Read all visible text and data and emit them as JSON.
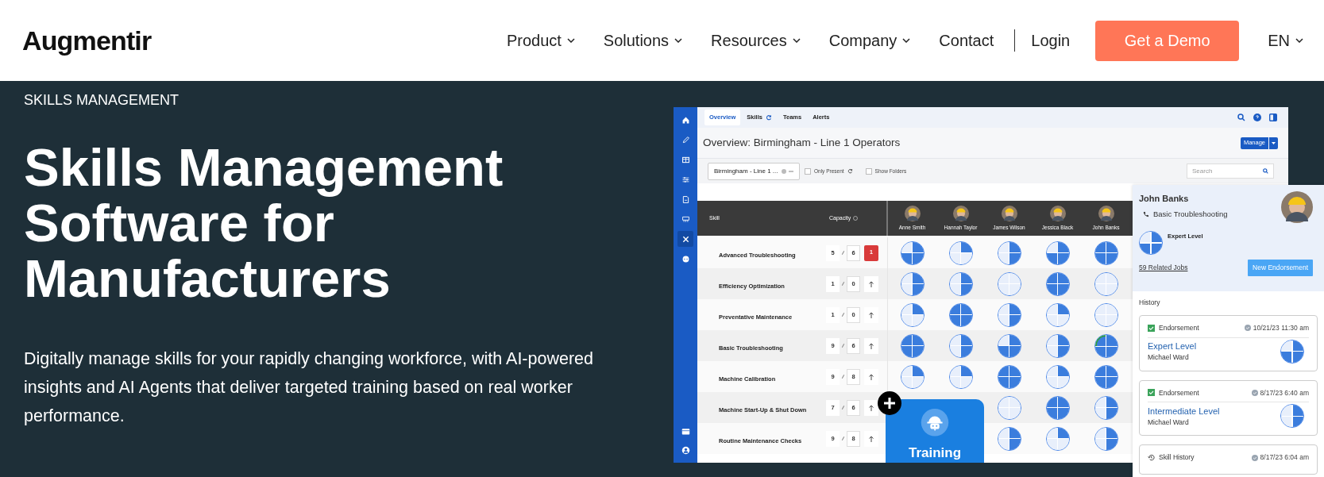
{
  "header": {
    "logo": "Augmentir",
    "nav": [
      {
        "label": "Product",
        "dropdown": true
      },
      {
        "label": "Solutions",
        "dropdown": true
      },
      {
        "label": "Resources",
        "dropdown": true
      },
      {
        "label": "Company",
        "dropdown": true
      },
      {
        "label": "Contact",
        "dropdown": false
      }
    ],
    "login": "Login",
    "cta": "Get a Demo",
    "language": {
      "label": "EN",
      "dropdown": true
    }
  },
  "hero": {
    "eyebrow": "SKILLS MANAGEMENT",
    "title": "Skills Management Software for Manufacturers",
    "description": "Digitally manage skills for your rapidly changing workforce, with AI-powered insights and AI Agents that deliver targeted training based on real worker performance."
  },
  "app": {
    "sidebar": [
      {
        "selected": false
      },
      {
        "selected": false
      },
      {
        "selected": false
      },
      {
        "selected": false
      },
      {
        "selected": false
      },
      {
        "selected": false
      },
      {
        "selected": true
      },
      {
        "selected": false
      }
    ],
    "tabs": [
      {
        "label": "Overview",
        "selected": true,
        "refresh": false
      },
      {
        "label": "Skills",
        "selected": false,
        "refresh": true
      },
      {
        "label": "Teams",
        "selected": false,
        "refresh": false
      },
      {
        "label": "Alerts",
        "selected": false,
        "refresh": false
      }
    ],
    "title": "Overview: Birmingham - Line 1 Operators",
    "manage": "Manage",
    "filter": {
      "value": "Birmingham - Line 1 ..."
    },
    "options": [
      {
        "label": "Only Present",
        "checked": false,
        "refresh": true
      },
      {
        "label": "Show Folders",
        "checked": false,
        "refresh": false
      }
    ],
    "search": {
      "placeholder": "Search"
    },
    "table": {
      "columns": [
        "Skill",
        "Capacity"
      ],
      "workers": [
        "Anne Smith",
        "Hannah Taylor",
        "James Wilson",
        "Jessica Black",
        "John Banks"
      ],
      "rows": [
        {
          "skill": "Advanced Troubleshooting",
          "have": "5",
          "need": "6",
          "kind": "alert",
          "alert": "1",
          "cells": [
            {
              "kind": "three_quarters"
            },
            {
              "kind": "quarter"
            },
            {
              "kind": "half"
            },
            {
              "kind": "three_quarters"
            },
            {
              "kind": "full"
            }
          ]
        },
        {
          "skill": "Efficiency Optimization",
          "have": "1",
          "need": "0",
          "kind": "arrow",
          "cells": [
            {
              "kind": "half"
            },
            {
              "kind": "half"
            },
            {
              "kind": "empty"
            },
            {
              "kind": "full"
            },
            {
              "kind": "empty"
            }
          ]
        },
        {
          "skill": "Preventative Maintenance",
          "have": "1",
          "need": "0",
          "kind": "arrow",
          "cells": [
            {
              "kind": "quarter"
            },
            {
              "kind": "full"
            },
            {
              "kind": "half"
            },
            {
              "kind": "quarter"
            },
            {
              "kind": "empty"
            }
          ]
        },
        {
          "skill": "Basic Troubleshooting",
          "have": "9",
          "need": "6",
          "kind": "arrow",
          "cells": [
            {
              "kind": "full"
            },
            {
              "kind": "half"
            },
            {
              "kind": "three_quarters"
            },
            {
              "kind": "half"
            },
            {
              "kind": "full",
              "highlighted": true
            }
          ]
        },
        {
          "skill": "Machine Calibration",
          "have": "9",
          "need": "8",
          "kind": "arrow",
          "cells": [
            {
              "kind": "quarter"
            },
            {
              "kind": "quarter"
            },
            {
              "kind": "full"
            },
            {
              "kind": "quarter"
            },
            {
              "kind": "full"
            }
          ]
        },
        {
          "skill": "Machine Start-Up & Shut Down",
          "have": "7",
          "need": "6",
          "kind": "arrow",
          "cells": [
            null,
            null,
            {
              "kind": "empty"
            },
            {
              "kind": "full"
            },
            {
              "kind": "half"
            }
          ]
        },
        {
          "skill": "Routine Maintenance Checks",
          "have": "9",
          "need": "8",
          "kind": "arrow",
          "cells": [
            null,
            null,
            {
              "kind": "half"
            },
            {
              "kind": "quarter"
            },
            {
              "kind": "half"
            }
          ]
        }
      ]
    }
  },
  "panel": {
    "name": "John Banks",
    "skill": "Basic Troubleshooting",
    "current": {
      "label": "Expert Level",
      "pie": {
        "kind": "three_quarters"
      }
    },
    "related": "59 Related Jobs",
    "button": "New Endorsement",
    "history_title": "History",
    "history": [
      {
        "kind": "endorsement",
        "type": "Endorsement",
        "date": "10/21/23 11:30 am",
        "title": "Expert Level",
        "by": "Michael Ward",
        "pie": {
          "kind": "three_quarters"
        }
      },
      {
        "kind": "endorsement",
        "type": "Endorsement",
        "date": "8/17/23 6:40 am",
        "title": "Intermediate Level",
        "by": "Michael Ward",
        "pie": {
          "kind": "half"
        }
      },
      {
        "kind": "history",
        "type": "Skill History",
        "date": "8/17/23 6:04 am"
      }
    ]
  },
  "training": {
    "label": "Training"
  }
}
